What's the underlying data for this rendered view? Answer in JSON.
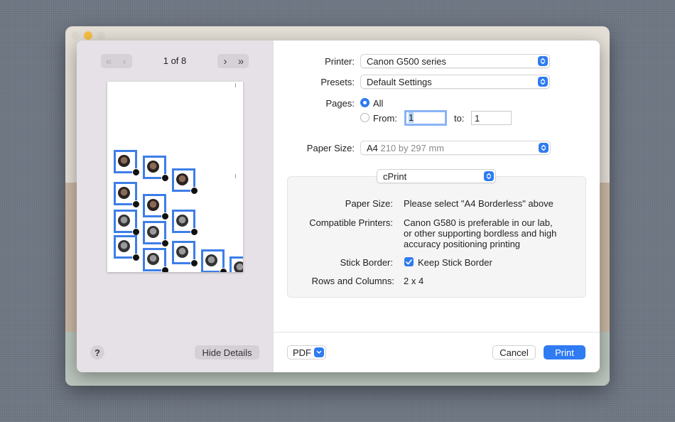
{
  "preview": {
    "page_indicator": "1 of 8",
    "first_page_label": "«",
    "prev_page_label": "‹",
    "next_page_label": "›",
    "last_page_label": "»"
  },
  "left_footer": {
    "help_label": "?",
    "hide_details_label": "Hide Details"
  },
  "printer": {
    "label": "Printer:",
    "value": "Canon G500 series"
  },
  "presets": {
    "label": "Presets:",
    "value": "Default Settings"
  },
  "pages": {
    "label": "Pages:",
    "all_label": "All",
    "from_label": "From:",
    "from_value": "1",
    "to_label": "to:",
    "to_value": "1",
    "selected": "all"
  },
  "paper_size": {
    "label": "Paper Size:",
    "value": "A4",
    "detail": "210 by 297 mm"
  },
  "section_popup": {
    "value": "cPrint"
  },
  "cprint": {
    "paper_size_label": "Paper Size:",
    "paper_size_value": "Please select \"A4 Borderless\" above",
    "compatible_label": "Compatible Printers:",
    "compatible_line1": "Canon G580 is preferable in our lab,",
    "compatible_line2": "or other supporting bordless and high",
    "compatible_line3": "accuracy positioning printing",
    "stick_border_label": "Stick Border:",
    "stick_border_checkbox_label": "Keep Stick Border",
    "stick_border_checked": true,
    "rows_cols_label": "Rows and Columns:",
    "rows_cols_value": "2 x 4"
  },
  "footer": {
    "pdf_label": "PDF",
    "cancel_label": "Cancel",
    "print_label": "Print"
  },
  "colors": {
    "accent": "#2f7bf2",
    "sticker_border": "#3d7ee8",
    "minimize_light": "#f6c046"
  },
  "icons": [
    "help-icon",
    "chevron-updown-icon",
    "chevron-down-icon",
    "checkmark-icon",
    "radio-selected-icon"
  ]
}
